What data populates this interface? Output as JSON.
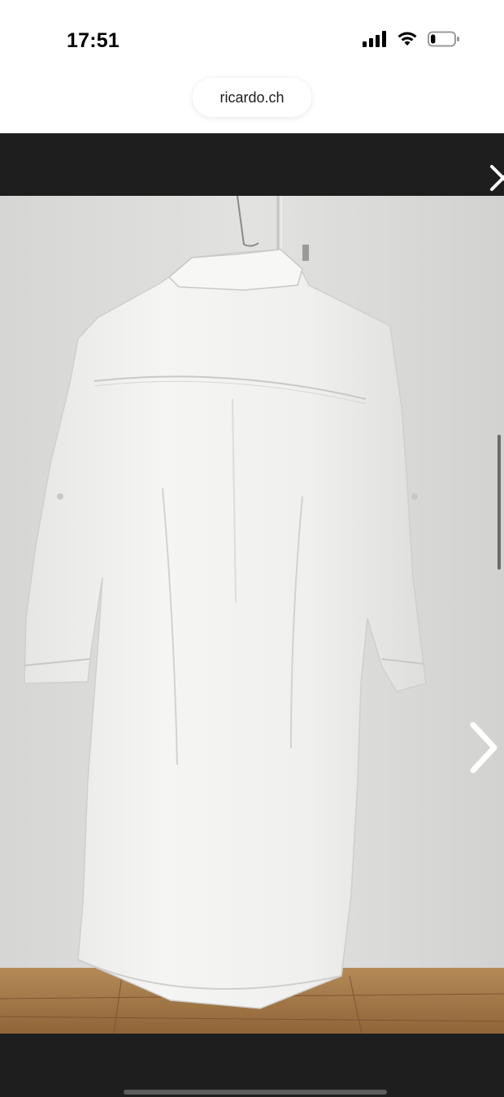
{
  "status_bar": {
    "time": "17:51",
    "signal_icon": "cellular-signal-icon",
    "wifi_icon": "wifi-icon",
    "battery_icon": "battery-icon",
    "battery_level": 0.2
  },
  "browser": {
    "url": "ricardo.ch"
  },
  "gallery": {
    "close_icon": "close-icon",
    "next_icon": "chevron-right-icon",
    "image_subject": "white-shirt-dress-on-hanger"
  },
  "colors": {
    "viewer_bg": "#1e1e1e",
    "wall": "#dcdcda",
    "floor": "#a97c4c",
    "garment": "#f2f2f0"
  }
}
